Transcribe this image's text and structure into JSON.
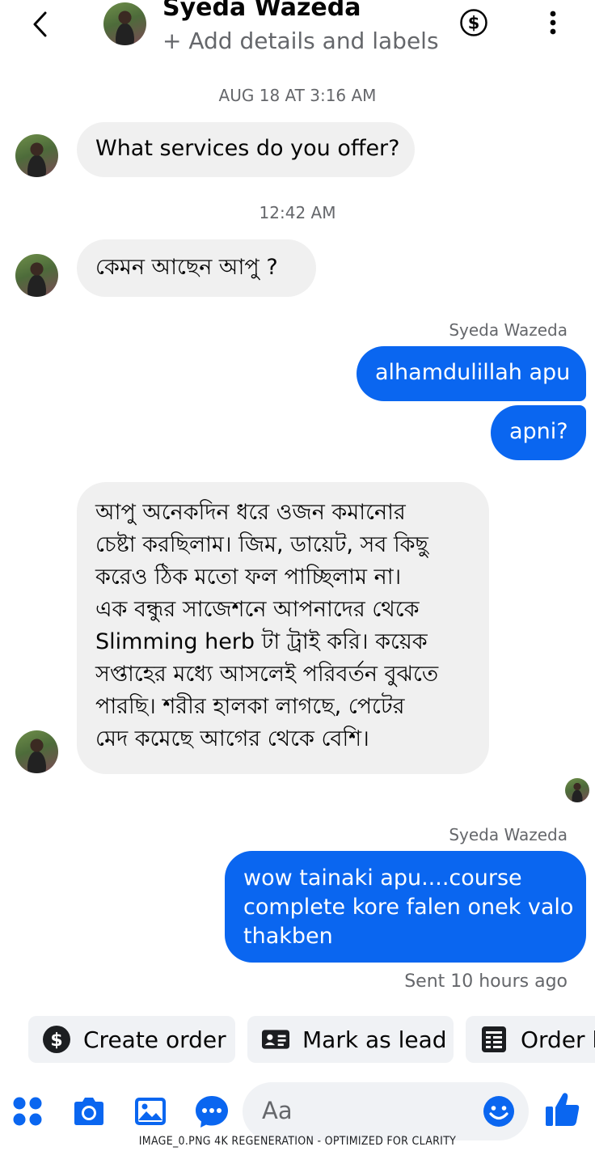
{
  "header": {
    "contact_name": "Syeda Wazeda",
    "subtitle": "+ Add details and labels"
  },
  "conversation": {
    "timestamp_1": "AUG 18 AT 3:16 AM",
    "msg_1": "What services do you offer?",
    "timestamp_2": "12:42 AM",
    "msg_2": "কেমন আছেন আপু ?",
    "sender_label_1": "Syeda Wazeda",
    "out_1": "alhamdulillah apu",
    "out_2": "apni?",
    "msg_3_lines": [
      "আপু অনেকদিন ধরে ওজন কমানোর",
      "চেষ্টা করছিলাম। জিম, ডায়েট, সব কিছু",
      "করেও ঠিক মতো ফল পাচ্ছিলাম না।",
      "এক বন্ধুর সাজেশনে আপনাদের থেকে",
      "Slimming herb টা ট্রাই করি। কয়েক",
      "সপ্তাহের মধ্যে আসলেই পরিবর্তন বুঝতে",
      "পারছি। শরীর হালকা লাগছে, পেটের",
      "মেদ কমেছে আগের থেকে বেশি।"
    ],
    "sender_label_2": "Syeda Wazeda",
    "out_3_lines": [
      "wow tainaki apu....course",
      "complete kore falen onek valo",
      "thakben"
    ],
    "delivery_status": "Sent 10 hours ago"
  },
  "quick_actions": [
    {
      "label": "Create order",
      "icon": "dollar-circle-icon"
    },
    {
      "label": "Mark as lead",
      "icon": "id-card-icon"
    },
    {
      "label": "Order h",
      "icon": "receipt-icon"
    }
  ],
  "composer": {
    "placeholder": "Aa"
  },
  "caption": "IMAGE_0.PNG 4K REGENERATION - OPTIMIZED FOR CLARITY",
  "colors": {
    "accent": "#0a66f0",
    "incoming_bubble": "#f0f0f0",
    "secondary_text": "#65676b"
  }
}
